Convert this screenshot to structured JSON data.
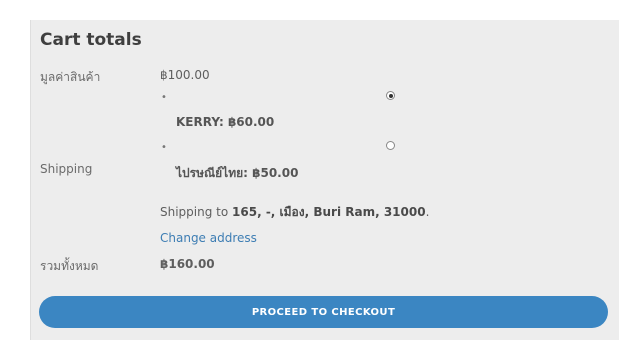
{
  "cart_totals": {
    "title": "Cart totals",
    "subtotal": {
      "label": "มูลค่าสินค้า",
      "value": "฿100.00"
    },
    "shipping": {
      "label": "Shipping",
      "options": [
        {
          "label": "KERRY: ฿60.00",
          "selected": true
        },
        {
          "label": "ไปรษณีย์ไทย: ฿50.00",
          "selected": false
        }
      ],
      "destination_prefix": "Shipping to ",
      "destination": "165, -, เมือง, Buri Ram, 31000",
      "destination_suffix": ".",
      "change_address": "Change address"
    },
    "total": {
      "label": "รวมทั้งหมด",
      "value": "฿160.00"
    },
    "checkout_button": "PROCEED TO CHECKOUT"
  }
}
